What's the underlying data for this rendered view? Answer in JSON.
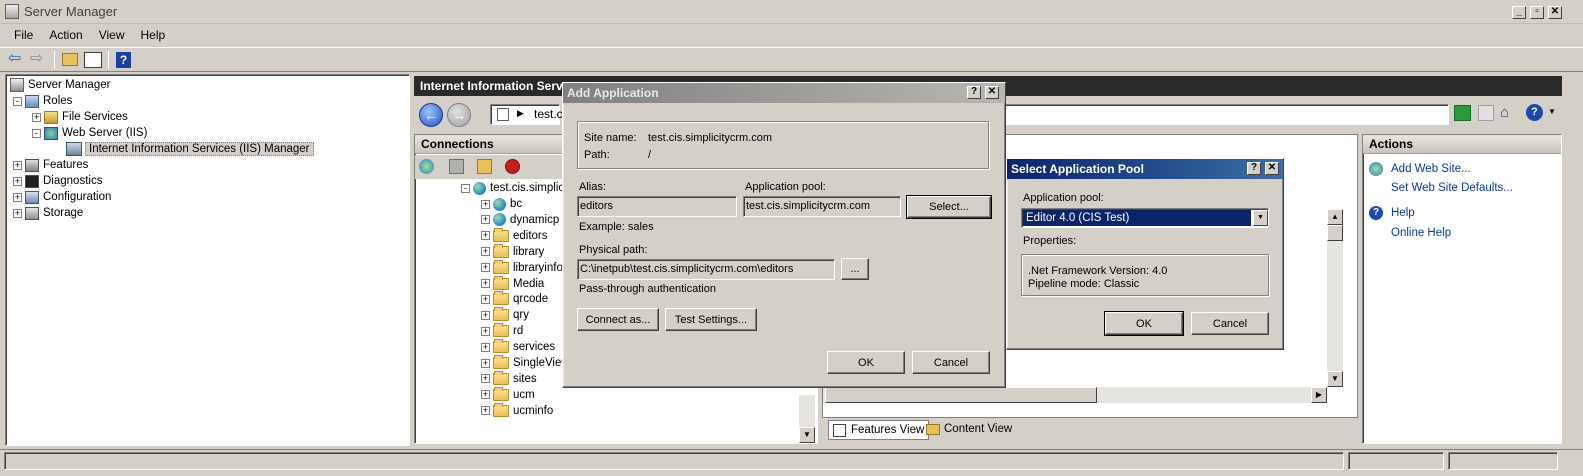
{
  "window": {
    "title": "Server Manager"
  },
  "menu": [
    "File",
    "Action",
    "View",
    "Help"
  ],
  "left_tree": [
    {
      "label": "Server Manager",
      "depth": 0,
      "expander": "",
      "icon": "server-icon"
    },
    {
      "label": "Roles",
      "depth": 1,
      "expander": "-",
      "icon": "roles-icon"
    },
    {
      "label": "File Services",
      "depth": 2,
      "expander": "+",
      "icon": "file-services-icon"
    },
    {
      "label": "Web Server (IIS)",
      "depth": 2,
      "expander": "-",
      "icon": "web-server-icon"
    },
    {
      "label": "Internet Information Services (IIS) Manager",
      "depth": 3,
      "expander": "",
      "icon": "iis-manager-icon",
      "selected": true
    },
    {
      "label": "Features",
      "depth": 1,
      "expander": "+",
      "icon": "features-icon"
    },
    {
      "label": "Diagnostics",
      "depth": 1,
      "expander": "+",
      "icon": "diagnostics-icon"
    },
    {
      "label": "Configuration",
      "depth": 1,
      "expander": "+",
      "icon": "configuration-icon"
    },
    {
      "label": "Storage",
      "depth": 1,
      "expander": "+",
      "icon": "storage-icon"
    }
  ],
  "iis": {
    "header": "Internet Information Serv",
    "address": "test.c",
    "connections_title": "Connections",
    "site": "test.cis.simplic",
    "children": [
      "bc",
      "dynamicp",
      "editors",
      "library",
      "libraryinfo",
      "Media",
      "qrcode",
      "qry",
      "rd",
      "services",
      "SingleView",
      "sites",
      "ucm",
      "ucminfo"
    ],
    "features_view": "Features View",
    "content_view": "Content View"
  },
  "actions": {
    "title": "Actions",
    "items": [
      "Add Web Site...",
      "Set Web Site Defaults...",
      "Help",
      "Online Help"
    ]
  },
  "add_app": {
    "title": "Add Application",
    "site_name_label": "Site name:",
    "site_name": "test.cis.simplicitycrm.com",
    "path_label": "Path:",
    "path": "/",
    "alias_label": "Alias:",
    "alias": "editors",
    "pool_label": "Application pool:",
    "pool": "test.cis.simplicitycrm.com",
    "select_btn": "Select...",
    "example": "Example: sales",
    "phys_label": "Physical path:",
    "phys": "C:\\inetpub\\test.cis.simplicitycrm.com\\editors",
    "browse_btn": "...",
    "pass_through": "Pass-through authentication",
    "connect_as": "Connect as...",
    "test_settings": "Test Settings...",
    "ok": "OK",
    "cancel": "Cancel"
  },
  "select_pool": {
    "title": "Select Application Pool",
    "pool_label": "Application pool:",
    "pool_value": "Editor 4.0 (CIS Test)",
    "props_label": "Properties:",
    "props_line1": ".Net Framework Version: 4.0",
    "props_line2": "Pipeline mode: Classic",
    "ok": "OK",
    "cancel": "Cancel"
  },
  "colors": {
    "title_active": "#0a246a",
    "title_inactive": "#808080",
    "link": "#0b3a99"
  }
}
